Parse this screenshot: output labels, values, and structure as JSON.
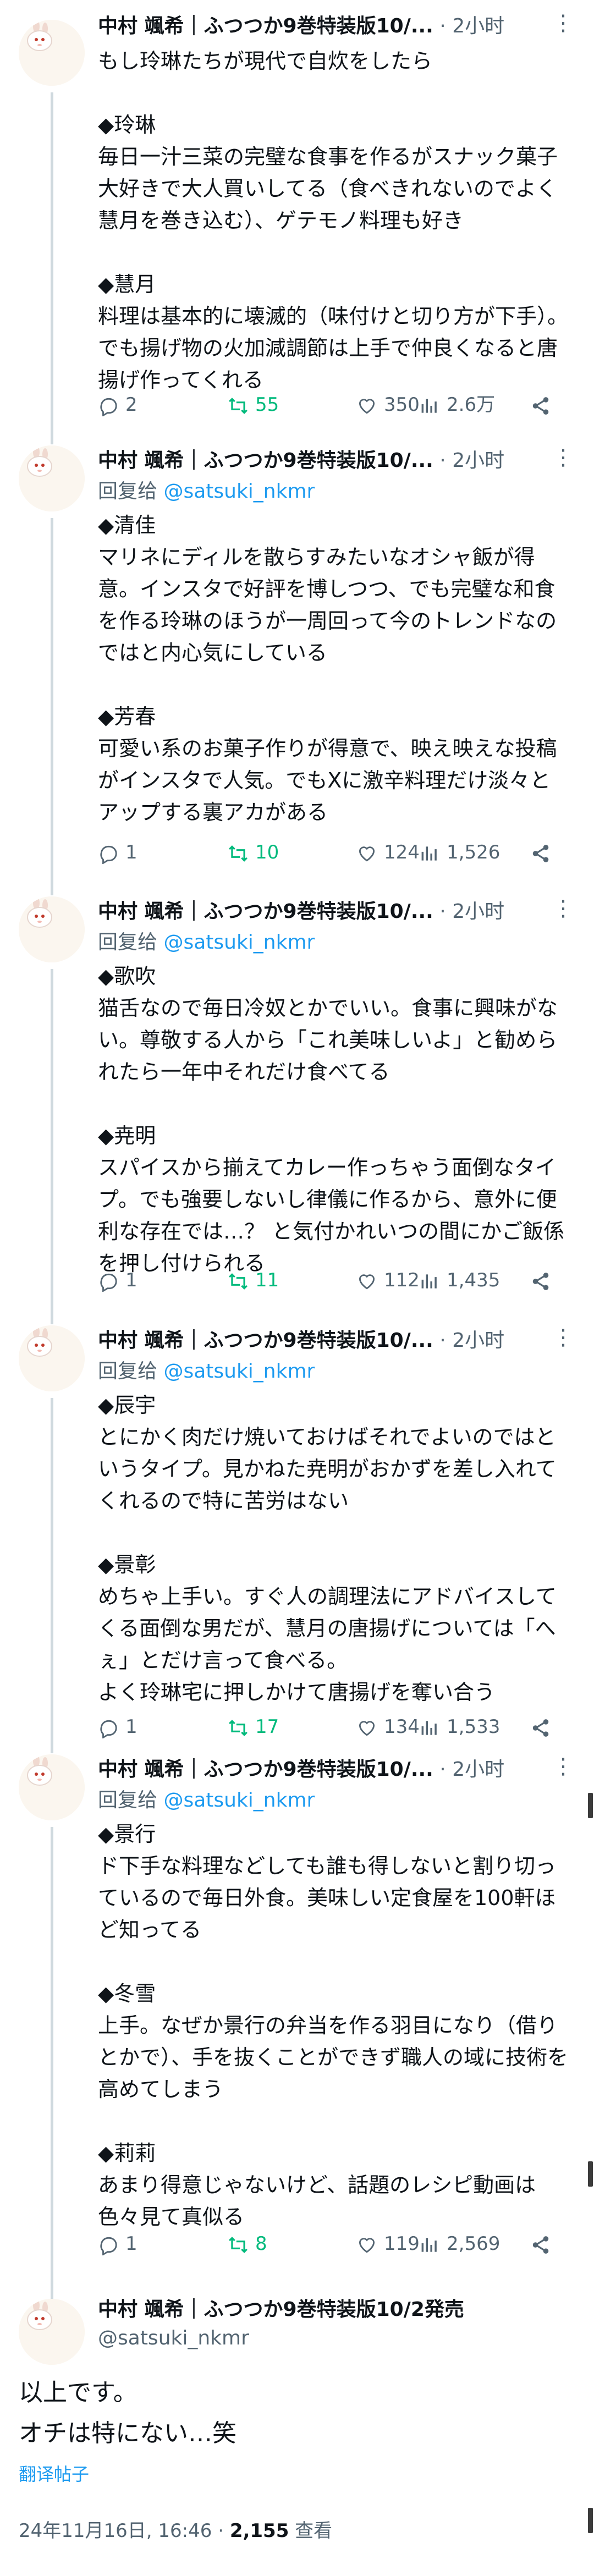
{
  "author": {
    "name": "中村 颯希｜ふつつか9巻特装版10/...",
    "full_name": "中村 颯希｜ふつつか9巻特装版10/2発売",
    "handle": "@satsuki_nkmr",
    "reply_prefix": "回复给 "
  },
  "time_sep": " · ",
  "tweets": [
    {
      "time": "2小时",
      "text": "もし玲琳たちが現代で自炊をしたら\n\n◆玲琳\n毎日一汁三菜の完璧な食事を作るがスナック菓子大好きで大人買いしてる（食べきれないのでよく慧月を巻き込む）、ゲテモノ料理も好き\n\n◆慧月\n料理は基本的に壊滅的（味付けと切り方が下手）。でも揚げ物の火加減調節は上手で仲良くなると唐揚げ作ってくれる",
      "replies": "2",
      "retweets": "55",
      "likes": "350",
      "views": "2.6万"
    },
    {
      "time": "2小时",
      "text": "◆清佳\nマリネにディルを散らすみたいなオシャ飯が得意。インスタで好評を博しつつ、でも完璧な和食を作る玲琳のほうが一周回って今のトレンドなのではと内心気にしている\n\n◆芳春\n可愛い系のお菓子作りが得意で、映え映えな投稿がインスタで人気。でもXに激辛料理だけ淡々とアップする裏アカがある",
      "replies": "1",
      "retweets": "10",
      "likes": "124",
      "views": "1,526"
    },
    {
      "time": "2小时",
      "text": "◆歌吹\n猫舌なので毎日冷奴とかでいい。食事に興味がない。尊敬する人から「これ美味しいよ」と勧められたら一年中それだけ食べてる\n\n◆尭明\nスパイスから揃えてカレー作っちゃう面倒なタイプ。でも強要しないし律儀に作るから、意外に便利な存在では…？ と気付かれいつの間にかご飯係を押し付けられる",
      "replies": "1",
      "retweets": "11",
      "likes": "112",
      "views": "1,435"
    },
    {
      "time": "2小时",
      "text": "◆辰宇\nとにかく肉だけ焼いておけばそれでよいのではというタイプ。見かねた尭明がおかずを差し入れてくれるので特に苦労はない\n\n◆景彰\nめちゃ上手い。すぐ人の調理法にアドバイスしてくる面倒な男だが、慧月の唐揚げについては「へぇ」とだけ言って食べる。\nよく玲琳宅に押しかけて唐揚げを奪い合う",
      "replies": "1",
      "retweets": "17",
      "likes": "134",
      "views": "1,533"
    },
    {
      "time": "2小时",
      "text": "◆景行\nド下手な料理などしても誰も得しないと割り切っているので毎日外食。美味しい定食屋を100軒ほど知ってる\n\n◆冬雪\n上手。なぜか景行の弁当を作る羽目になり（借りとかで）、手を抜くことができず職人の域に技術を高めてしまう\n\n◆莉莉\nあまり得意じゃないけど、話題のレシピ動画は色々見て真似る",
      "replies": "1",
      "retweets": "8",
      "likes": "119",
      "views": "2,569"
    }
  ],
  "final": {
    "text": "以上です。\nオチは特にない…笑",
    "translate_label": "翻译帖子",
    "timestamp": "24年11月16日, 16:46",
    "views_count": "2,155",
    "views_label": " 查看"
  },
  "colors": {
    "text": "#0f1419",
    "muted": "#536471",
    "link": "#1d9bf0",
    "retweet_active": "#00ba7c",
    "thread_line": "#cfd9de"
  },
  "icons": [
    "reply-icon",
    "retweet-icon",
    "like-icon",
    "views-icon",
    "share-icon",
    "more-icon",
    "avatar-rabbit"
  ]
}
